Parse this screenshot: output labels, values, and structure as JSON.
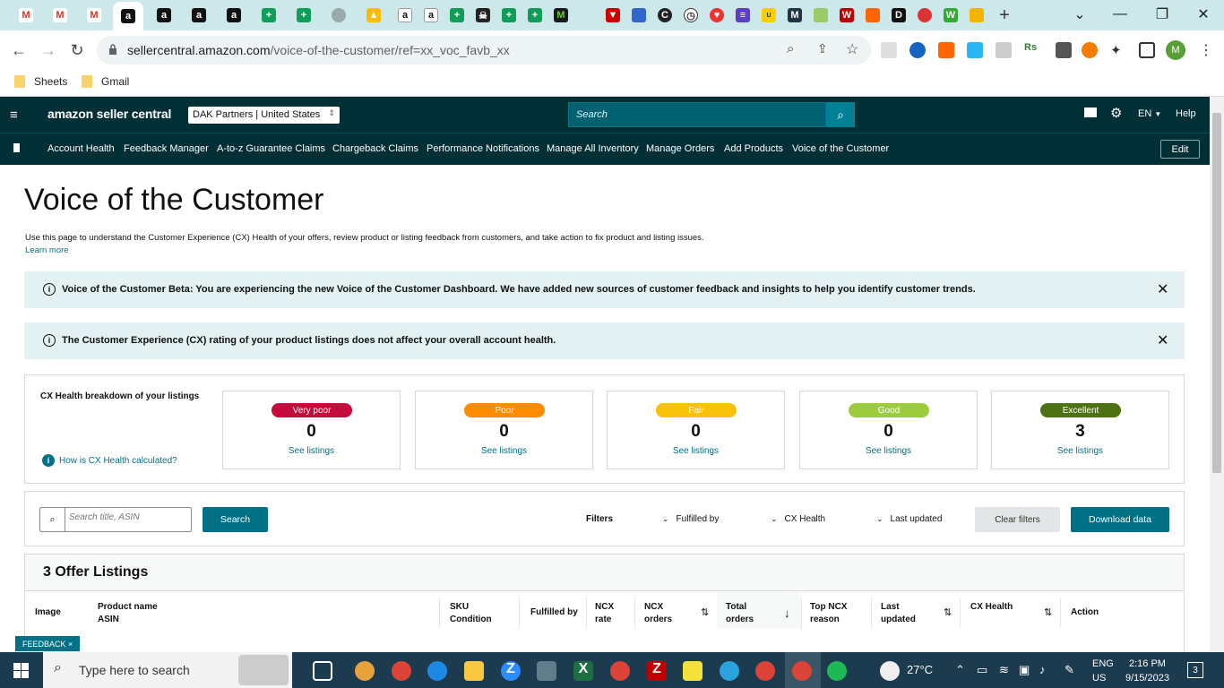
{
  "browser": {
    "url_domain": "sellercentral.amazon.com",
    "url_path": "/voice-of-the-customer/ref=xx_voc_favb_xx",
    "bookmarks": [
      "Sheets",
      "Gmail"
    ]
  },
  "header": {
    "logo": "amazon seller central",
    "account": "DAK Partners | United States",
    "search_placeholder": "Search",
    "lang": "EN",
    "help": "Help"
  },
  "nav": {
    "links": [
      "Account Health",
      "Feedback Manager",
      "A-to-z Guarantee Claims",
      "Chargeback Claims",
      "Performance Notifications",
      "Manage All Inventory",
      "Manage Orders",
      "Add Products",
      "Voice of the Customer"
    ],
    "edit": "Edit"
  },
  "page": {
    "title": "Voice of the Customer",
    "description": "Use this page to understand the Customer Experience (CX) Health of your offers, review product or listing feedback from customers, and take action to fix product and listing issues.",
    "learn_more": "Learn more"
  },
  "alerts": [
    {
      "text": "Voice of the Customer Beta: You are experiencing the new Voice of the Customer Dashboard. We have added new sources of customer feedback and insights to help you identify customer trends."
    },
    {
      "text": "The Customer Experience (CX) rating of your product listings does not affect your overall account health."
    }
  ],
  "breakdown": {
    "title": "CX Health breakdown of your listings",
    "how_link": "How is CX Health calculated?",
    "cards": [
      {
        "label": "Very poor",
        "count": "0",
        "link": "See listings",
        "color": "#c40b3b",
        "text_color": "#ffffff"
      },
      {
        "label": "Poor",
        "count": "0",
        "link": "See listings",
        "color": "#ff8c00",
        "text_color": "#ffffff"
      },
      {
        "label": "Fair",
        "count": "0",
        "link": "See listings",
        "color": "#f8c20a",
        "text_color": "#ffffff"
      },
      {
        "label": "Good",
        "count": "0",
        "link": "See listings",
        "color": "#9ccc3c",
        "text_color": "#ffffff"
      },
      {
        "label": "Excellent",
        "count": "3",
        "link": "See listings",
        "color": "#4e7213",
        "text_color": "#ffffff"
      }
    ]
  },
  "filters": {
    "search_placeholder": "Search title, ASIN",
    "search_button": "Search",
    "label": "Filters",
    "dropdowns": [
      "Fulfilled by",
      "CX Health",
      "Last updated"
    ],
    "clear": "Clear filters",
    "download": "Download data"
  },
  "listings": {
    "title": "3 Offer Listings",
    "columns": [
      {
        "line1": "Image",
        "line2": ""
      },
      {
        "line1": "Product name",
        "line2": "ASIN"
      },
      {
        "line1": "SKU",
        "line2": "Condition"
      },
      {
        "line1": "Fulfilled by",
        "line2": ""
      },
      {
        "line1": "NCX",
        "line2": "rate"
      },
      {
        "line1": "NCX",
        "line2": "orders"
      },
      {
        "line1": "Total",
        "line2": "orders"
      },
      {
        "line1": "Top NCX",
        "line2": "reason"
      },
      {
        "line1": "Last",
        "line2": "updated"
      },
      {
        "line1": "CX Health",
        "line2": ""
      },
      {
        "line1": "Action",
        "line2": ""
      }
    ]
  },
  "feedback": "FEEDBACK ×",
  "taskbar": {
    "search": "Type here to search",
    "weather": "27°C",
    "lang1": "ENG",
    "lang2": "US",
    "time": "2:16 PM",
    "date": "9/15/2023",
    "notifications": "3"
  }
}
